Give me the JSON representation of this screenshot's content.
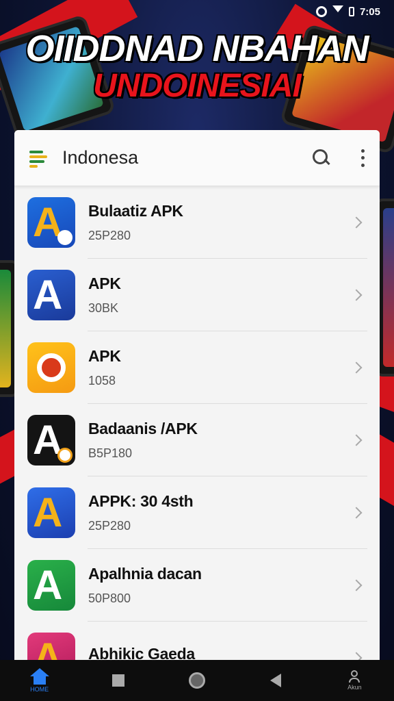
{
  "status_bar": {
    "time": "7:05"
  },
  "headline": {
    "line1": "OIIDDNAD NBAHAN",
    "line2": "UNDOINESIAI"
  },
  "app_bar": {
    "title": "Indonesa"
  },
  "apps": [
    {
      "name": "Bulaatiz APK",
      "size": "25P280",
      "glyph": "A"
    },
    {
      "name": "APK",
      "size": "30BK",
      "glyph": "A"
    },
    {
      "name": "APK",
      "size": "1058",
      "glyph": ""
    },
    {
      "name": "Badaanis /APK",
      "size": "B5P180",
      "glyph": "A"
    },
    {
      "name": "APPK: 30 4sth",
      "size": "25P280",
      "glyph": "A"
    },
    {
      "name": "Apalhnia dacan",
      "size": "50P800",
      "glyph": "A"
    },
    {
      "name": "Abhikic Gaeda",
      "size": "",
      "glyph": "A"
    }
  ],
  "nav": {
    "home_label": "HOME",
    "profile_label": "Akun"
  },
  "colors": {
    "accent": "#2a7ff5",
    "headline_red": "#e8141c",
    "card_bg": "#f4f4f4"
  }
}
